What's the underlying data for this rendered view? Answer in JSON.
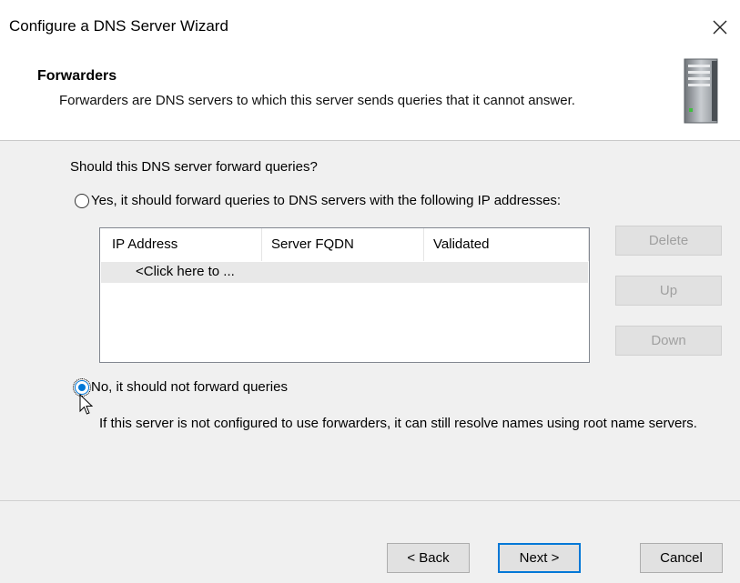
{
  "window": {
    "title": "Configure a DNS Server Wizard",
    "close_glyph": "✕"
  },
  "header": {
    "title": "Forwarders",
    "description": "Forwarders are DNS servers to which this server sends queries that it cannot answer.",
    "icon": "server-icon"
  },
  "content": {
    "question": "Should this DNS server forward queries?",
    "option_yes": {
      "label": "Yes, it should forward queries to DNS servers with the following IP addresses:",
      "selected": false
    },
    "option_no": {
      "label": "No, it should not forward queries",
      "selected": true
    },
    "info": "If this server is not configured to use forwarders, it can still resolve names using root name servers."
  },
  "forwarders_table": {
    "columns": [
      "IP Address",
      "Server FQDN",
      "Validated"
    ],
    "placeholder_row": "<Click here to ..."
  },
  "side_buttons": {
    "delete": "Delete",
    "up": "Up",
    "down": "Down"
  },
  "footer": {
    "back": "< Back",
    "next": "Next >",
    "cancel": "Cancel"
  },
  "colors": {
    "accent": "#0078d7",
    "panel": "#f0f0f0",
    "disabled_text": "#a0a0a0"
  }
}
